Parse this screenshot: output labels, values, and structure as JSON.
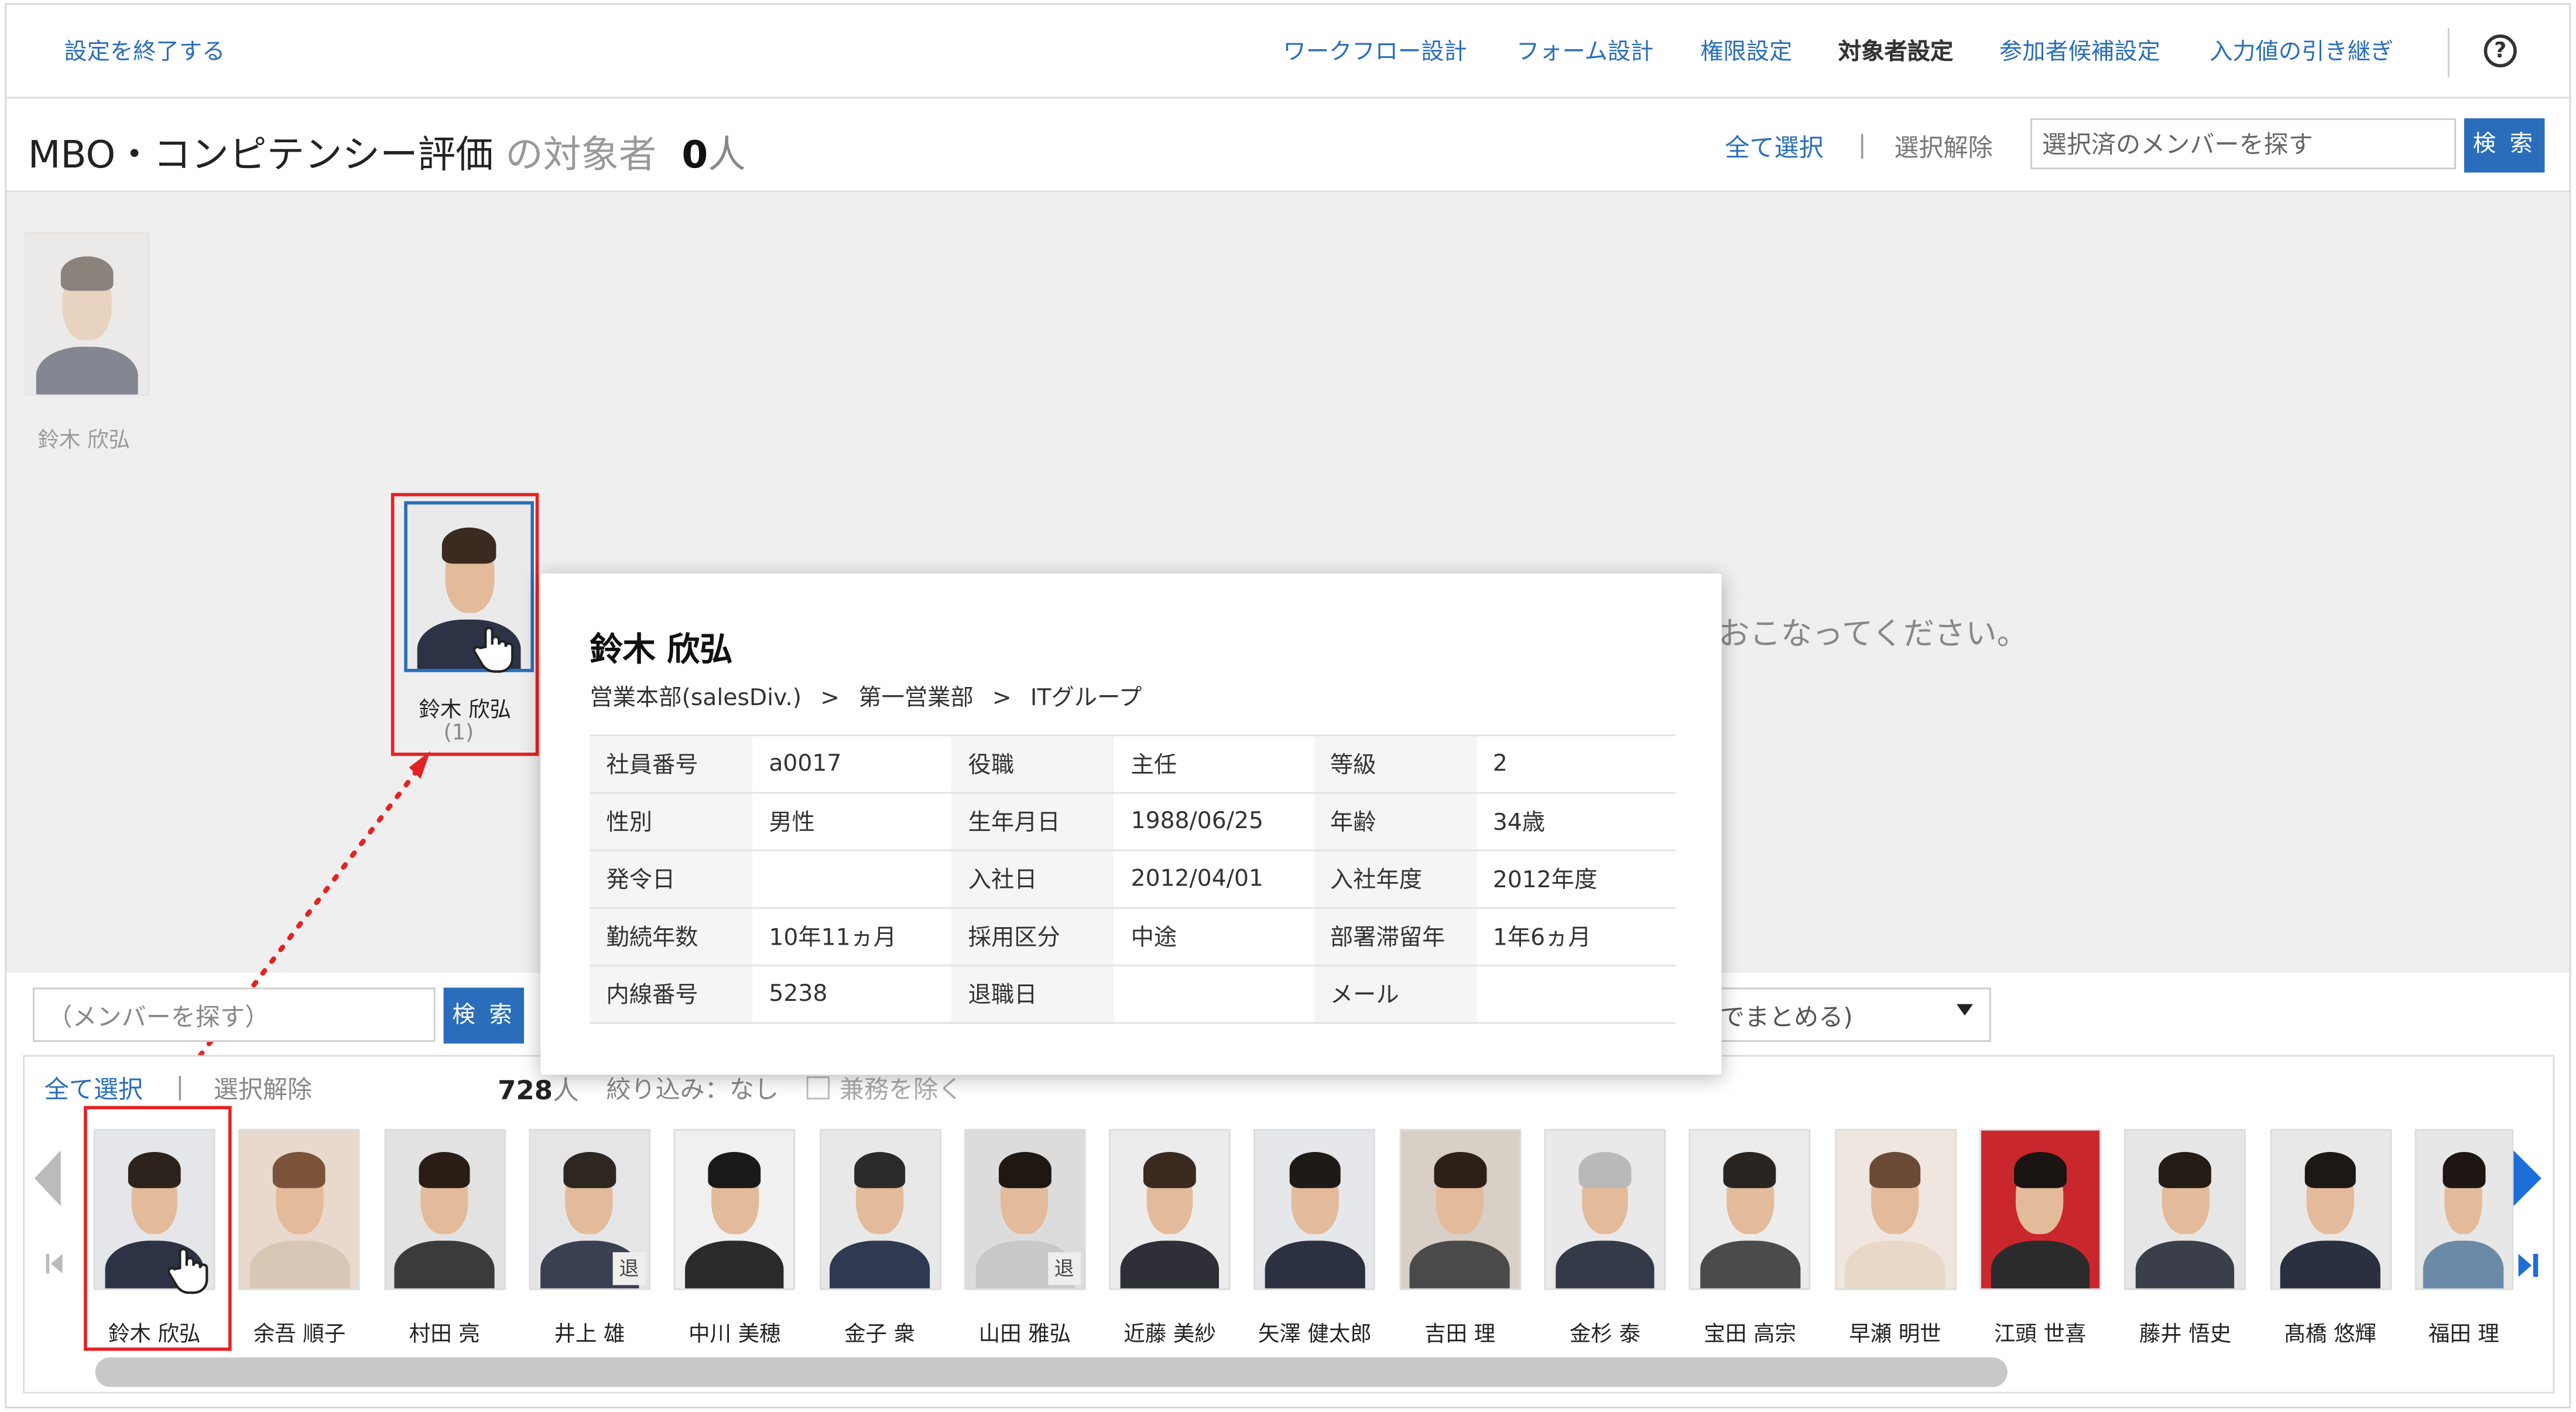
{
  "topbar": {
    "exit_label": "設定を終了する",
    "nav": [
      "ワークフロー設計",
      "フォーム設計",
      "権限設定",
      "対象者設定",
      "参加者候補設定",
      "入力値の引き継ぎ"
    ],
    "active_nav": "対象者設定",
    "help_icon": "?"
  },
  "header": {
    "title": "MBO・コンピテンシー評価",
    "title_suffix": "の対象者",
    "count": "0",
    "count_unit": "人",
    "select_all": "全て選択",
    "separator": "|",
    "deselect": "選択解除",
    "search_placeholder": "選択済のメンバーを探す",
    "search_button": "検 索"
  },
  "target_area": {
    "ghost_member_name": "鈴木 欣弘",
    "hint_text": "おこなってください。",
    "dragging": {
      "name": "鈴木 欣弘",
      "count": "(1)"
    }
  },
  "profile_card": {
    "name": "鈴木 欣弘",
    "breadcrumb": [
      "営業本部(salesDiv.)",
      "第一営業部",
      "ITグループ"
    ],
    "crumb_separator": ">",
    "rows": [
      [
        {
          "k": "社員番号",
          "v": "a0017"
        },
        {
          "k": "役職",
          "v": "主任"
        },
        {
          "k": "等級",
          "v": "2"
        }
      ],
      [
        {
          "k": "性別",
          "v": "男性"
        },
        {
          "k": "生年月日",
          "v": "1988/06/25"
        },
        {
          "k": "年齢",
          "v": "34歳"
        }
      ],
      [
        {
          "k": "発令日",
          "v": ""
        },
        {
          "k": "入社日",
          "v": "2012/04/01"
        },
        {
          "k": "入社年度",
          "v": "2012年度"
        }
      ],
      [
        {
          "k": "勤続年数",
          "v": "10年11ヵ月"
        },
        {
          "k": "採用区分",
          "v": "中途"
        },
        {
          "k": "部署滞留年",
          "v": "1年6ヵ月"
        }
      ],
      [
        {
          "k": "内線番号",
          "v": "5238"
        },
        {
          "k": "退職日",
          "v": ""
        },
        {
          "k": "メール",
          "v": ""
        }
      ]
    ]
  },
  "member_search": {
    "placeholder": "（メンバーを探す）",
    "button": "検 索",
    "group_select": "でまとめる)"
  },
  "member_panel": {
    "select_all": "全て選択",
    "separator": "|",
    "deselect": "選択解除",
    "count": "728",
    "count_unit": "人",
    "filter": "絞り込み：なし",
    "exclude_concurrent": "兼務を除く",
    "retired_badge": "退",
    "members": [
      {
        "name": "鈴木 欣弘",
        "retired": false
      },
      {
        "name": "余吾 順子",
        "retired": false
      },
      {
        "name": "村田 亮",
        "retired": false
      },
      {
        "name": "井上 雄",
        "retired": true
      },
      {
        "name": "中川 美穂",
        "retired": false
      },
      {
        "name": "金子 衆",
        "retired": false
      },
      {
        "name": "山田 雅弘",
        "retired": true
      },
      {
        "name": "近藤 美紗",
        "retired": false
      },
      {
        "name": "矢澤 健太郎",
        "retired": false
      },
      {
        "name": "吉田 理",
        "retired": false
      },
      {
        "name": "金杉 泰",
        "retired": false
      },
      {
        "name": "宝田 高宗",
        "retired": false
      },
      {
        "name": "早瀬 明世",
        "retired": false
      },
      {
        "name": "江頭 世喜",
        "retired": false
      },
      {
        "name": "藤井 悟史",
        "retired": false
      },
      {
        "name": "髙橋 悠輝",
        "retired": false
      },
      {
        "name": "福田 理",
        "retired": false
      }
    ]
  },
  "colors": {
    "accent": "#2a6ebb",
    "highlight": "#e52222",
    "nav_arrow": "#1d6ed8"
  }
}
